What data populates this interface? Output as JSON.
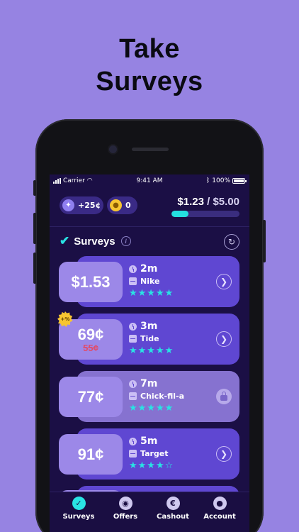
{
  "headline": {
    "line1": "Take",
    "line2": "Surveys"
  },
  "status_bar": {
    "carrier": "Carrier",
    "time": "9:41 AM",
    "battery": "100%"
  },
  "header": {
    "bonus_pill": "+25¢",
    "coins_pill": "0",
    "balance_current": "$1.23",
    "balance_separator": " / ",
    "balance_goal": "$5.00",
    "progress_fraction": 0.246
  },
  "section": {
    "title": "Surveys",
    "info_glyph": "i"
  },
  "surveys": [
    {
      "price": "$1.53",
      "old_price": "",
      "time": "2m",
      "brand": "Nike",
      "stars": "★★★★★",
      "locked": false
    },
    {
      "price": "69¢",
      "old_price": "55¢",
      "time": "3m",
      "brand": "Tide",
      "stars": "★★★★★",
      "locked": false,
      "badge": "+%"
    },
    {
      "price": "77¢",
      "old_price": "",
      "time": "7m",
      "brand": "Chick-fil-a",
      "stars": "★★★★★",
      "locked": true
    },
    {
      "price": "91¢",
      "old_price": "",
      "time": "5m",
      "brand": "Target",
      "stars": "★★★★☆",
      "locked": false
    }
  ],
  "tabs": [
    {
      "label": "Surveys",
      "icon": "check-icon"
    },
    {
      "label": "Offers",
      "icon": "gamepad-icon"
    },
    {
      "label": "Cashout",
      "icon": "euro-icon"
    },
    {
      "label": "Account",
      "icon": "user-icon"
    }
  ],
  "colors": {
    "background": "#9683e2",
    "screen": "#1b0f45",
    "accent": "#29e3e3",
    "card": "#5f47d2"
  }
}
